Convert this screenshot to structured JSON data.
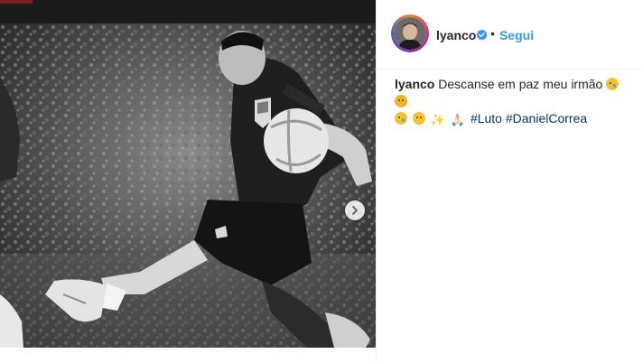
{
  "post": {
    "photo_alt": "",
    "carousel": {
      "slides": 3,
      "active": 1
    }
  },
  "header": {
    "username": "lyanco",
    "verified": true,
    "separator": "•",
    "follow_label": "Segui"
  },
  "caption": {
    "username": "lyanco",
    "text": "Descanse em paz meu irmão",
    "emojis": [
      "crying-face",
      "sad-face",
      "loudly-crying-face",
      "pensive-face",
      "sparkles",
      "folded-hands"
    ],
    "sparkles_glyph": "✨",
    "hands_glyph": "🙏🏻",
    "hashtags": [
      "#Luto",
      "#DanielCorrea"
    ]
  },
  "colors": {
    "link": "#3897f0",
    "hashtag": "#003569",
    "verified": "#3897f0"
  }
}
